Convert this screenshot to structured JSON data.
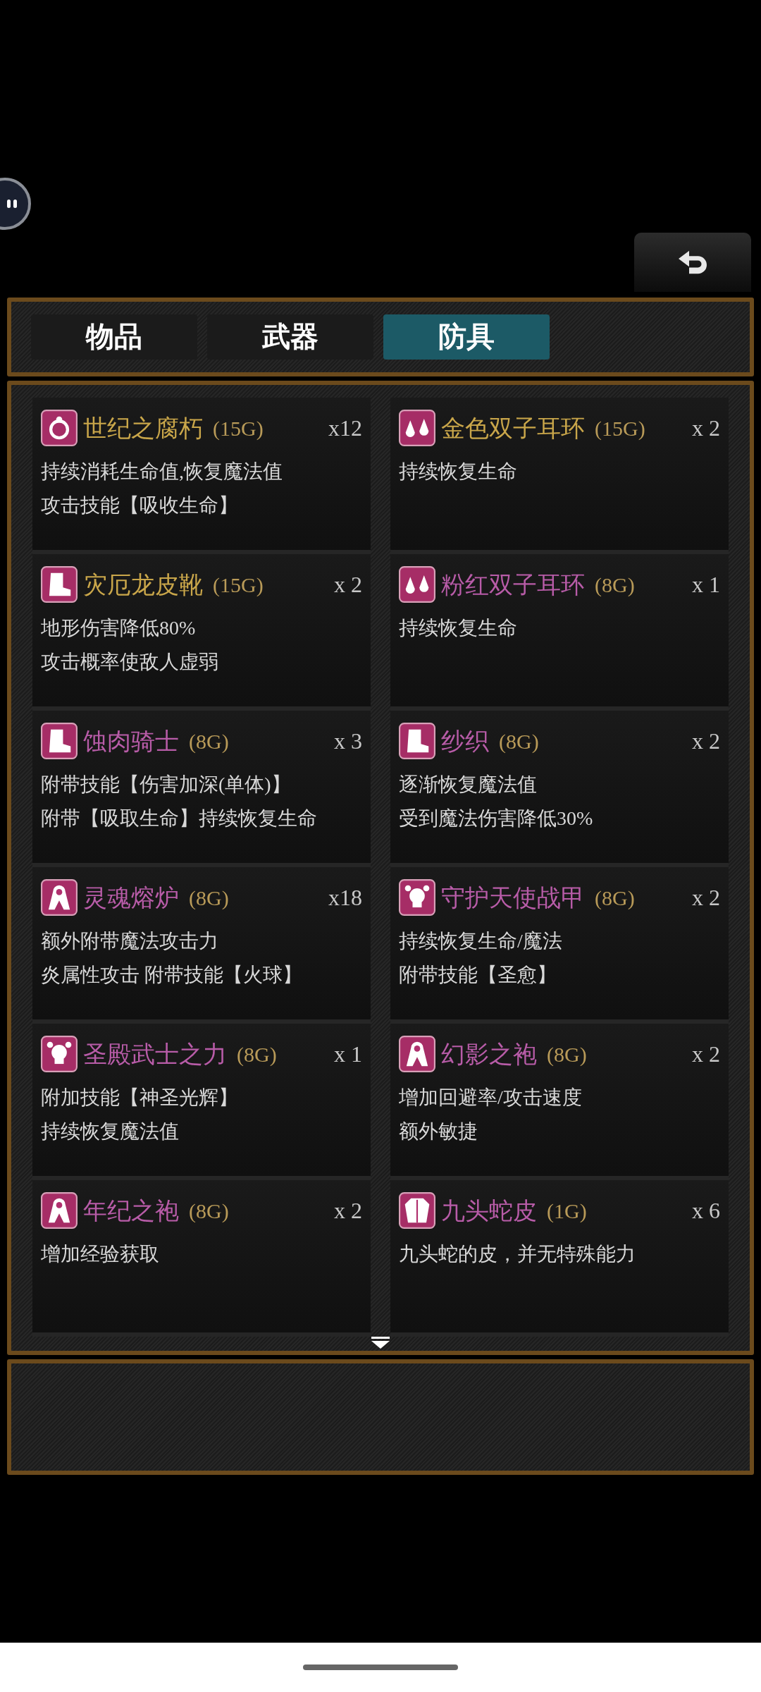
{
  "tabs": [
    {
      "label": "物品",
      "selected": false
    },
    {
      "label": "武器",
      "selected": false
    },
    {
      "label": "防具",
      "selected": true
    }
  ],
  "items": [
    {
      "kind": "ring",
      "name": "世纪之腐朽",
      "price": "(15G)",
      "quantity": "x12",
      "color": "#c9a64a",
      "lines": [
        "持续消耗生命值,恢复魔法值",
        "攻击技能【吸收生命】"
      ]
    },
    {
      "kind": "earring",
      "name": "金色双子耳环",
      "price": "(15G)",
      "quantity": "x 2",
      "color": "#c9a64a",
      "lines": [
        "持续恢复生命"
      ]
    },
    {
      "kind": "boot",
      "name": "灾厄龙皮靴",
      "price": "(15G)",
      "quantity": "x 2",
      "color": "#c9a64a",
      "lines": [
        "地形伤害降低80%",
        "攻击概率使敌人虚弱"
      ]
    },
    {
      "kind": "earring",
      "name": "粉红双子耳环",
      "price": "(8G)",
      "quantity": "x 1",
      "color": "#b85ca8",
      "lines": [
        "持续恢复生命"
      ]
    },
    {
      "kind": "boot",
      "name": "蚀肉骑士",
      "price": "(8G)",
      "quantity": "x 3",
      "color": "#b85ca8",
      "lines": [
        "附带技能【伤害加深(单体)】",
        "附带【吸取生命】持续恢复生命"
      ]
    },
    {
      "kind": "boot",
      "name": "纱织",
      "price": "(8G)",
      "quantity": "x 2",
      "color": "#b85ca8",
      "lines": [
        "逐渐恢复魔法值",
        "受到魔法伤害降低30%"
      ]
    },
    {
      "kind": "robe",
      "name": "灵魂熔炉",
      "price": "(8G)",
      "quantity": "x18",
      "color": "#b85ca8",
      "lines": [
        "额外附带魔法攻击力",
        "炎属性攻击 附带技能【火球】"
      ]
    },
    {
      "kind": "skull",
      "name": "守护天使战甲",
      "price": "(8G)",
      "quantity": "x 2",
      "color": "#b85ca8",
      "lines": [
        "持续恢复生命/魔法",
        "附带技能【圣愈】"
      ]
    },
    {
      "kind": "skull",
      "name": "圣殿武士之力",
      "price": "(8G)",
      "quantity": "x 1",
      "color": "#b85ca8",
      "lines": [
        "附加技能【神圣光辉】",
        "持续恢复魔法值"
      ]
    },
    {
      "kind": "robe",
      "name": "幻影之袍",
      "price": "(8G)",
      "quantity": "x 2",
      "color": "#b85ca8",
      "lines": [
        "增加回避率/攻击速度",
        "额外敏捷"
      ]
    },
    {
      "kind": "robe",
      "name": "年纪之袍",
      "price": "(8G)",
      "quantity": "x 2",
      "color": "#b85ca8",
      "lines": [
        "增加经验获取"
      ]
    },
    {
      "kind": "coat",
      "name": "九头蛇皮",
      "price": "(1G)",
      "quantity": "x 6",
      "color": "#b85ca8",
      "lines": [
        "九头蛇的皮，并无特殊能力"
      ]
    }
  ]
}
